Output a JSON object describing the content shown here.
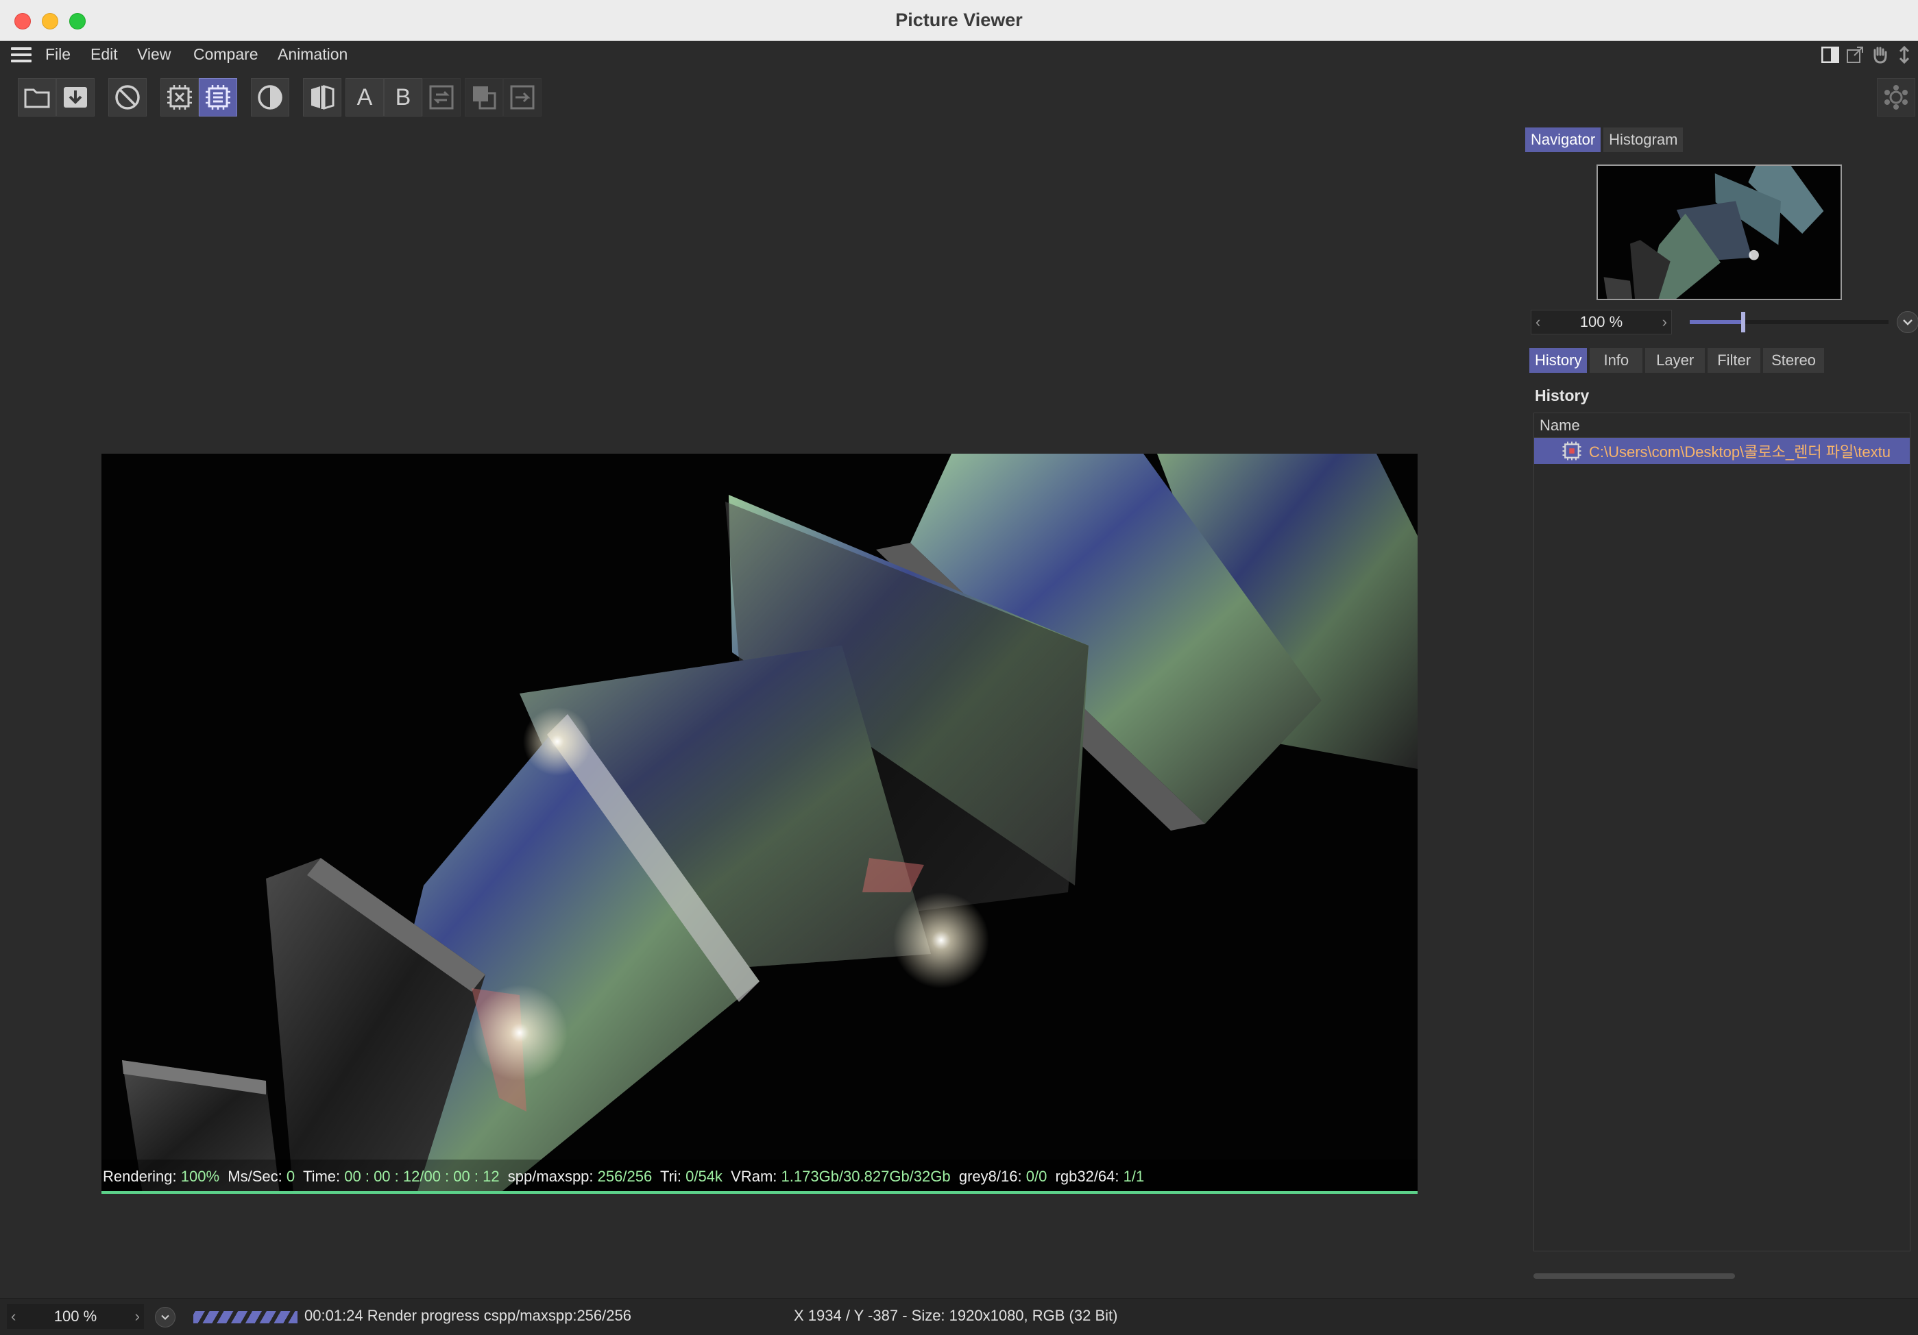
{
  "window": {
    "title": "Picture Viewer"
  },
  "menu": {
    "items": [
      "File",
      "Edit",
      "View",
      "Compare",
      "Animation"
    ]
  },
  "toolbar": {
    "buttons": [
      {
        "icon": "folder-open-icon",
        "state": "normal"
      },
      {
        "icon": "save-download-icon",
        "state": "normal"
      },
      {
        "icon": "stop-render-icon",
        "state": "normal"
      },
      {
        "icon": "render-region-icon",
        "state": "normal"
      },
      {
        "icon": "render-full-icon",
        "state": "active"
      },
      {
        "icon": "contrast-icon",
        "state": "normal"
      },
      {
        "icon": "ab-compare-icon",
        "state": "normal"
      },
      {
        "icon": "set-a-icon",
        "label": "A",
        "state": "normal"
      },
      {
        "icon": "set-b-icon",
        "label": "B",
        "state": "normal"
      },
      {
        "icon": "swap-icon",
        "state": "disabled"
      },
      {
        "icon": "layer-copy-icon",
        "state": "disabled"
      },
      {
        "icon": "export-icon",
        "state": "disabled"
      }
    ],
    "a_label": "A",
    "b_label": "B"
  },
  "render_info": {
    "rendering_label": "Rendering:",
    "rendering_value": "100%",
    "mssec_label": "Ms/Sec:",
    "mssec_value": "0",
    "time_label": "Time:",
    "time_value": "00 : 00 : 12/00 : 00 : 12",
    "spp_label": "spp/maxspp:",
    "spp_value": "256/256",
    "tri_label": "Tri:",
    "tri_value": "0/54k",
    "vram_label": "VRam:",
    "vram_value": "1.173Gb/30.827Gb/32Gb",
    "grey_label": "grey8/16:",
    "grey_value": "0/0",
    "rgb_label": "rgb32/64:",
    "rgb_value": "1/1"
  },
  "panel": {
    "top_tabs": [
      {
        "label": "Navigator",
        "selected": true
      },
      {
        "label": "Histogram",
        "selected": false
      }
    ],
    "zoom": "100 %",
    "zoom_slider_fraction": 0.27,
    "mid_tabs": [
      {
        "label": "History",
        "selected": true
      },
      {
        "label": "Info",
        "selected": false
      },
      {
        "label": "Layer",
        "selected": false
      },
      {
        "label": "Filter",
        "selected": false
      },
      {
        "label": "Stereo",
        "selected": false
      }
    ],
    "section_title": "History",
    "table_header": "Name",
    "history_rows": [
      {
        "name": "C:\\Users\\com\\Desktop\\콜로소_렌더 파일\\textu"
      }
    ]
  },
  "status": {
    "zoom": "100 %",
    "render_progress": "00:01:24 Render progress  cspp/maxspp:256/256",
    "coords": "X 1934 / Y -387 - Size: 1920x1080, RGB (32 Bit)"
  },
  "colors": {
    "accent": "#5b5fa8",
    "history_text": "#f7b46b",
    "render_value_green": "#9ff0a3",
    "progress_line": "#5cd18a"
  }
}
